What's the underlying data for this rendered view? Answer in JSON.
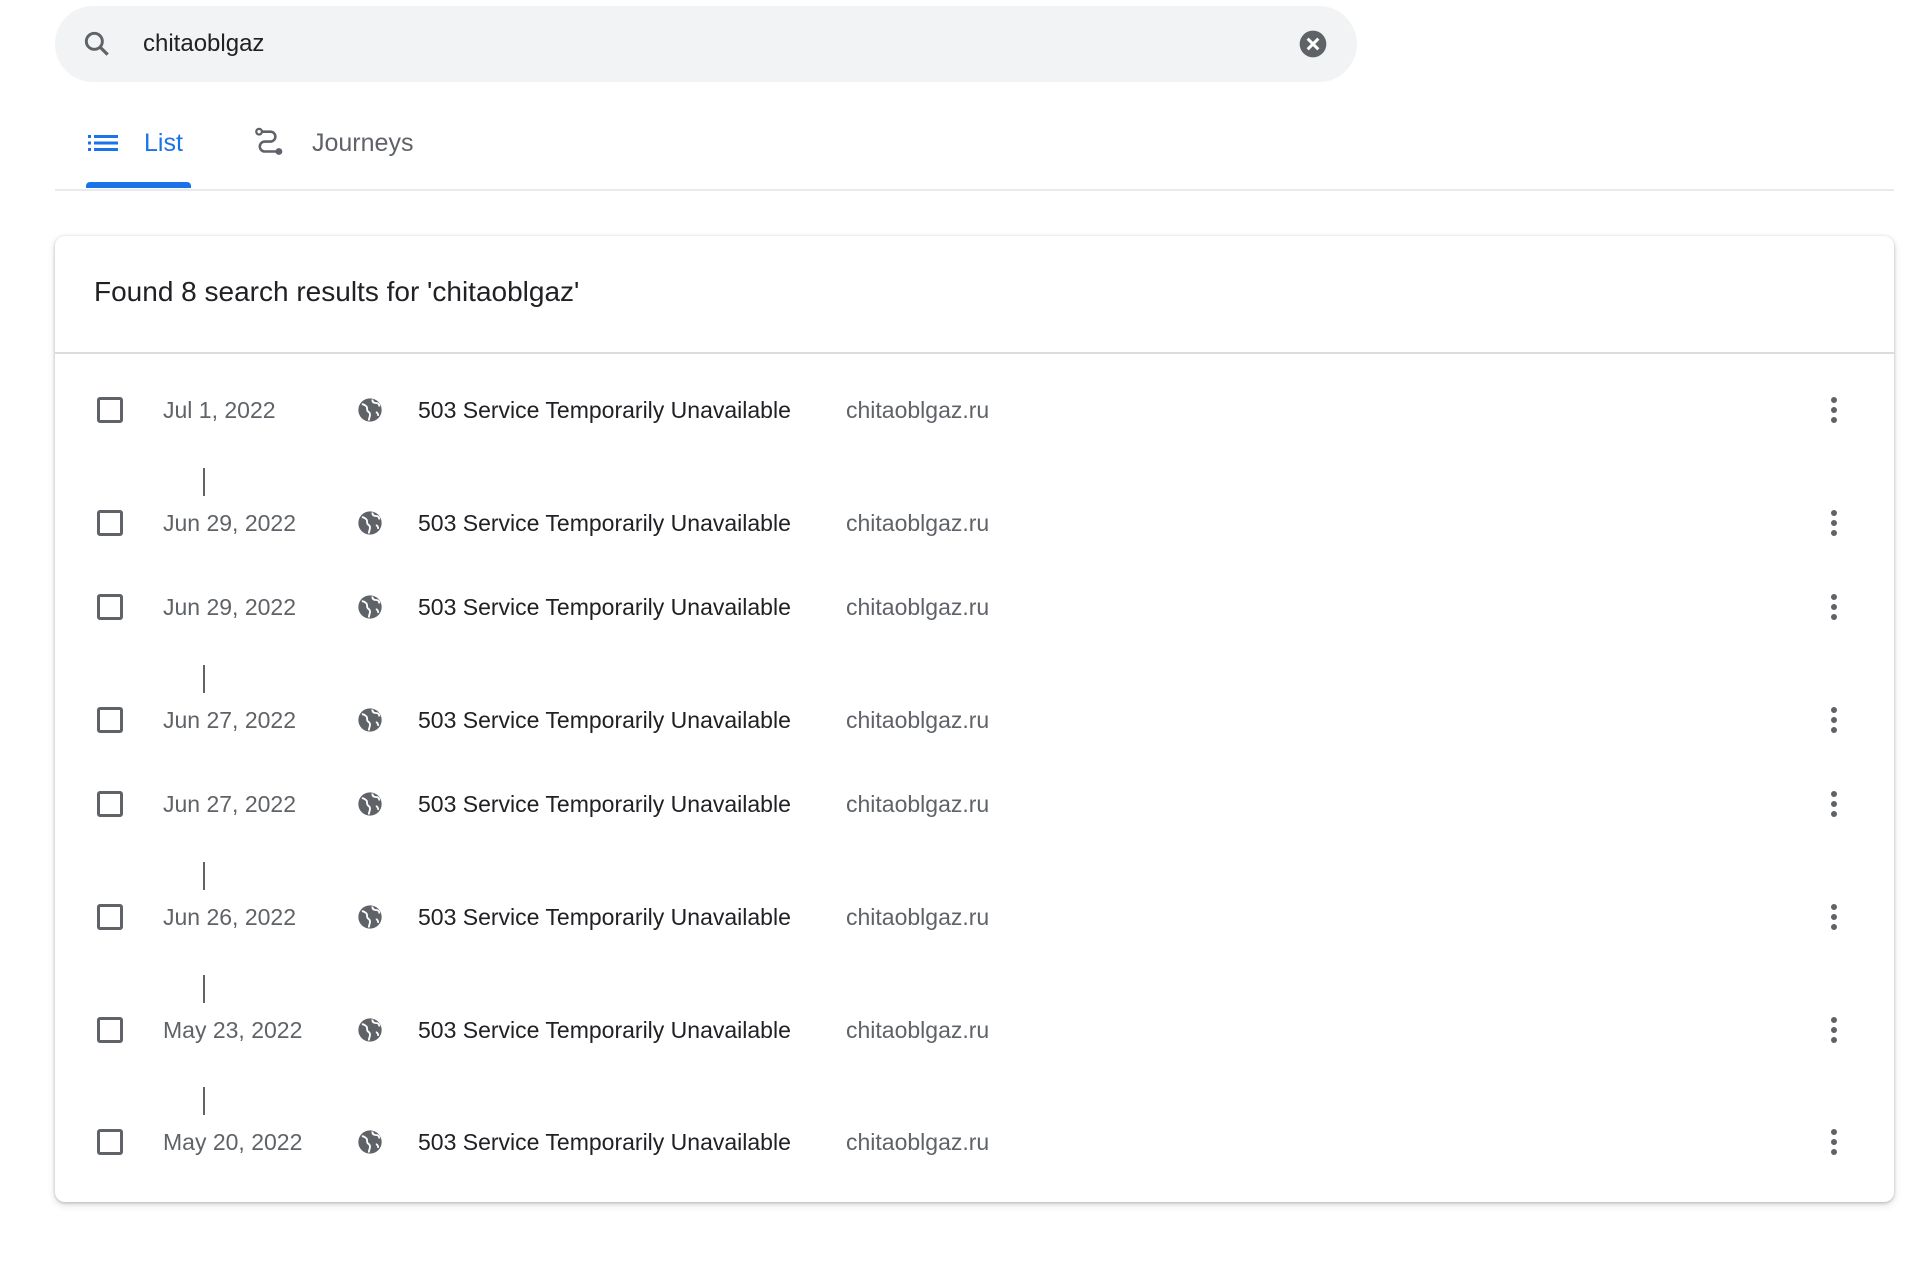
{
  "search": {
    "value": "chitaoblgaz",
    "search_icon": "search-icon",
    "clear_icon": "cancel-icon"
  },
  "tabs": [
    {
      "label": "List",
      "icon": "list-icon",
      "active": true
    },
    {
      "label": "Journeys",
      "icon": "route-icon",
      "active": false
    }
  ],
  "results": {
    "heading": "Found 8 search results for 'chitaoblgaz'",
    "items": [
      {
        "date": "Jul 1, 2022",
        "title": "503 Service Temporarily Unavailable",
        "domain": "chitaoblgaz.ru"
      },
      {
        "date": "Jun 29, 2022",
        "title": "503 Service Temporarily Unavailable",
        "domain": "chitaoblgaz.ru"
      },
      {
        "date": "Jun 29, 2022",
        "title": "503 Service Temporarily Unavailable",
        "domain": "chitaoblgaz.ru"
      },
      {
        "date": "Jun 27, 2022",
        "title": "503 Service Temporarily Unavailable",
        "domain": "chitaoblgaz.ru"
      },
      {
        "date": "Jun 27, 2022",
        "title": "503 Service Temporarily Unavailable",
        "domain": "chitaoblgaz.ru"
      },
      {
        "date": "Jun 26, 2022",
        "title": "503 Service Temporarily Unavailable",
        "domain": "chitaoblgaz.ru"
      },
      {
        "date": "May 23, 2022",
        "title": "503 Service Temporarily Unavailable",
        "domain": "chitaoblgaz.ru"
      },
      {
        "date": "May 20, 2022",
        "title": "503 Service Temporarily Unavailable",
        "domain": "chitaoblgaz.ru"
      }
    ]
  },
  "colors": {
    "accent": "#1a73e8",
    "text_secondary": "#5f6368",
    "search_bg": "#f1f3f4"
  }
}
